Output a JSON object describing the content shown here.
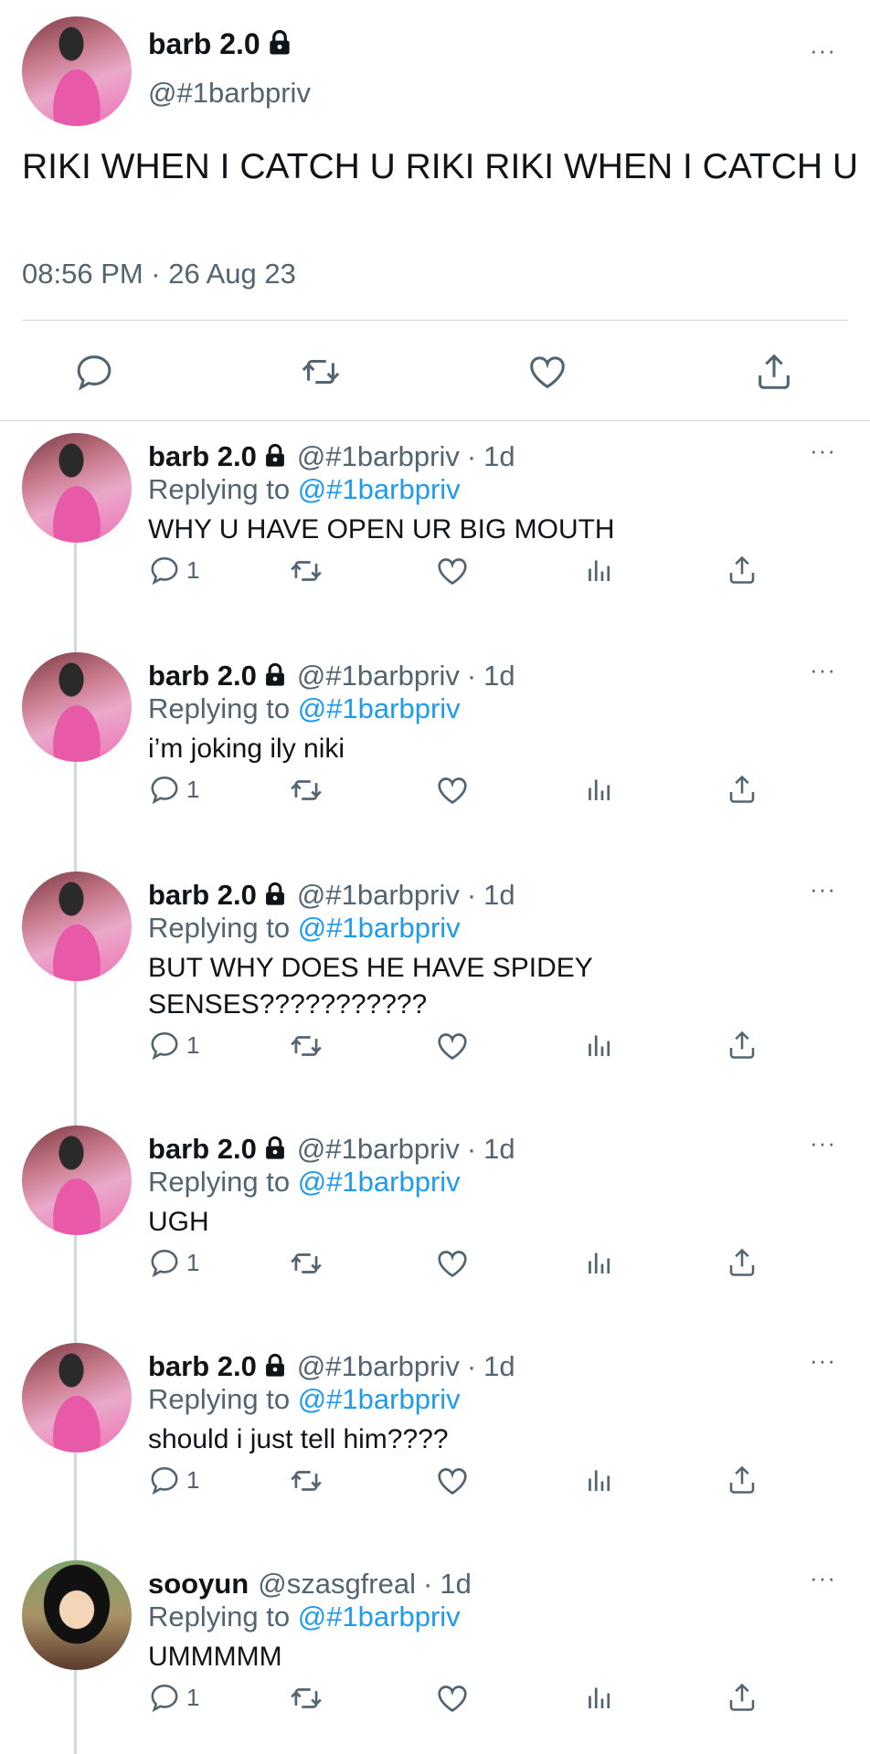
{
  "main_tweet": {
    "name": "barb 2.0",
    "handle": "@#1barbpriv",
    "text": "RIKI WHEN I CATCH U RIKI RIKI WHEN I CATCH U",
    "timestamp": "08:56 PM · 26 Aug 23",
    "actions": [
      "reply-icon",
      "retweet-icon",
      "like-icon",
      "share-icon"
    ]
  },
  "replies": [
    {
      "name": "barb 2.0",
      "handle": "@#1barbpriv",
      "time": "1d",
      "replying_label": "Replying to",
      "replying_to": "@#1barbpriv",
      "text": "WHY U HAVE OPEN UR BIG MOUTH",
      "reply_count": "1"
    },
    {
      "name": "barb 2.0",
      "handle": "@#1barbpriv",
      "time": "1d",
      "replying_label": "Replying to",
      "replying_to": "@#1barbpriv",
      "text": "i’m joking ily niki",
      "reply_count": "1"
    },
    {
      "name": "barb 2.0",
      "handle": "@#1barbpriv",
      "time": "1d",
      "replying_label": "Replying to",
      "replying_to": "@#1barbpriv",
      "text": "BUT WHY DOES HE HAVE SPIDEY SENSES???????????",
      "reply_count": "1"
    },
    {
      "name": "barb 2.0",
      "handle": "@#1barbpriv",
      "time": "1d",
      "replying_label": "Replying to",
      "replying_to": "@#1barbpriv",
      "text": "UGH",
      "reply_count": "1"
    },
    {
      "name": "barb 2.0",
      "handle": "@#1barbpriv",
      "time": "1d",
      "replying_label": "Replying to",
      "replying_to": "@#1barbpriv",
      "text": "should i just tell him????",
      "reply_count": "1"
    },
    {
      "name": "sooyun",
      "handle": "@szasgfreal",
      "time": "1d",
      "replying_label": "Replying to",
      "replying_to": "@#1barbpriv",
      "text": "UMMMMM",
      "reply_count": "1"
    }
  ],
  "separator": "·",
  "more_label": "···",
  "colors": {
    "link": "#1d9bf0",
    "secondary": "#536471",
    "text": "#0f1419",
    "divider": "#cfd9de"
  }
}
